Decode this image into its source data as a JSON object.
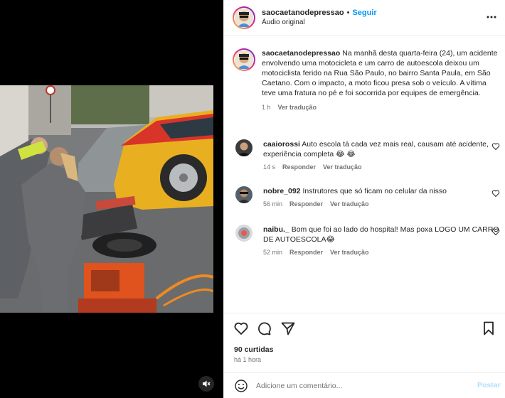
{
  "post": {
    "username": "saocaetanodepressao",
    "follow_label": "Seguir",
    "audio_label": "Áudio original",
    "caption": "Na manhã desta quarta-feira (24), um acidente envolvendo uma motocicleta e um carro de autoescola deixou um motociclista ferido na Rua São Paulo, no bairro Santa Paula, em São Caetano. Com o impacto, a moto ficou presa sob o veículo. A vítima teve uma fratura no pé e foi socorrida por equipes de emergência.",
    "caption_time": "1 h",
    "see_translation": "Ver tradução",
    "likes": "90 curtidas",
    "posted_ago": "há 1 hora"
  },
  "comments": [
    {
      "username": "caaiorossi",
      "text": "Auto escola tá cada vez mais real, causam até acidente, experiência completa 😂 😂",
      "time": "14 s",
      "reply": "Responder",
      "translate": "Ver tradução"
    },
    {
      "username": "nobre_092",
      "text": "Instrutores que só ficam no celular da nisso",
      "time": "56 min",
      "reply": "Responder",
      "translate": "Ver tradução"
    },
    {
      "username": "naibu._",
      "text": "Bom que foi ao lado do hospital! Mas poxa LOGO UM CARRO DE AUTOESCOLA😂",
      "time": "52 min",
      "reply": "Responder",
      "translate": "Ver tradução"
    }
  ],
  "composer": {
    "placeholder": "Adicione um comentário...",
    "post_label": "Postar"
  },
  "icons": [
    "more-options-icon",
    "like-icon",
    "comment-icon",
    "share-icon",
    "save-icon",
    "emoji-icon",
    "mute-icon",
    "heart-icon"
  ],
  "colors": {
    "follow_blue": "#0095f6",
    "post_disabled": "#b2dffc",
    "secondary_text": "#737373"
  }
}
